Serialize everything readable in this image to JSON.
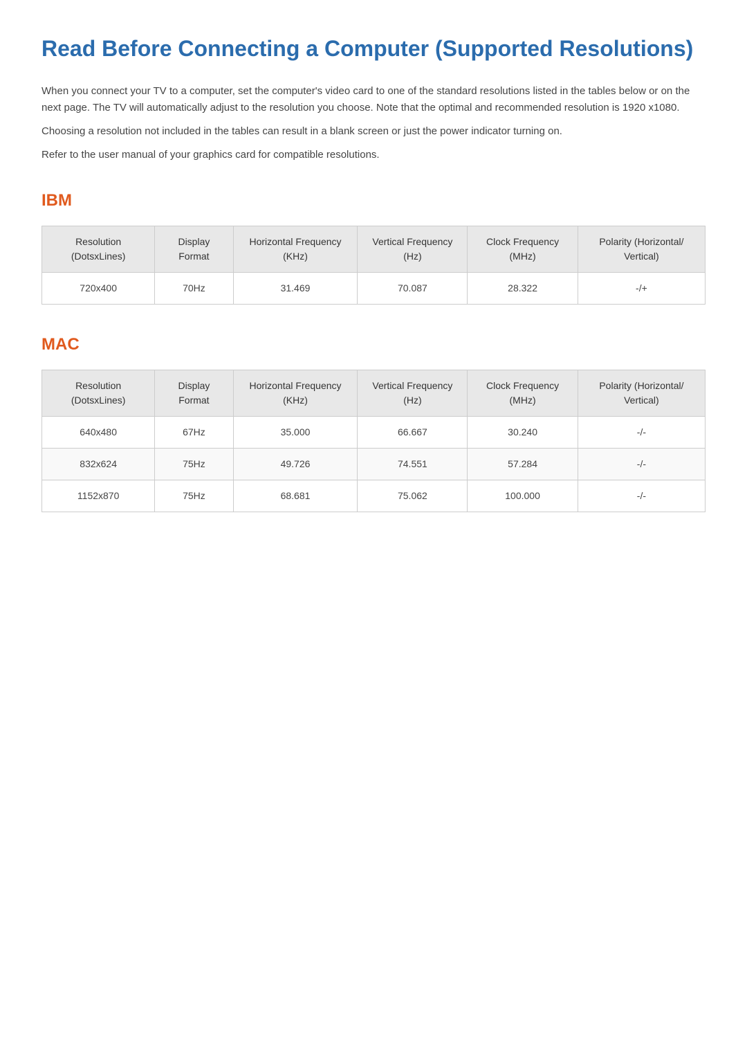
{
  "page": {
    "title": "Read Before Connecting a Computer (Supported Resolutions)",
    "intro": [
      "When you connect your TV to a computer, set the computer's video card to one of the standard resolutions listed in the tables below or on the next page. The TV will automatically adjust to the resolution you choose. Note that the optimal and recommended resolution is 1920 x1080.",
      "Choosing a resolution not included in the tables can result in a blank screen or just the power indicator turning on.",
      "Refer to the user manual of your graphics card for compatible resolutions."
    ]
  },
  "sections": [
    {
      "id": "ibm",
      "title": "IBM",
      "columns": [
        "Resolution (DotsxLines)",
        "Display Format",
        "Horizontal Frequency (KHz)",
        "Vertical Frequency (Hz)",
        "Clock Frequency (MHz)",
        "Polarity (Horizontal/ Vertical)"
      ],
      "rows": [
        [
          "720x400",
          "70Hz",
          "31.469",
          "70.087",
          "28.322",
          "-/+"
        ]
      ]
    },
    {
      "id": "mac",
      "title": "MAC",
      "columns": [
        "Resolution (DotsxLines)",
        "Display Format",
        "Horizontal Frequency (KHz)",
        "Vertical Frequency (Hz)",
        "Clock Frequency (MHz)",
        "Polarity (Horizontal/ Vertical)"
      ],
      "rows": [
        [
          "640x480",
          "67Hz",
          "35.000",
          "66.667",
          "30.240",
          "-/-"
        ],
        [
          "832x624",
          "75Hz",
          "49.726",
          "74.551",
          "57.284",
          "-/-"
        ],
        [
          "1152x870",
          "75Hz",
          "68.681",
          "75.062",
          "100.000",
          "-/-"
        ]
      ]
    }
  ]
}
